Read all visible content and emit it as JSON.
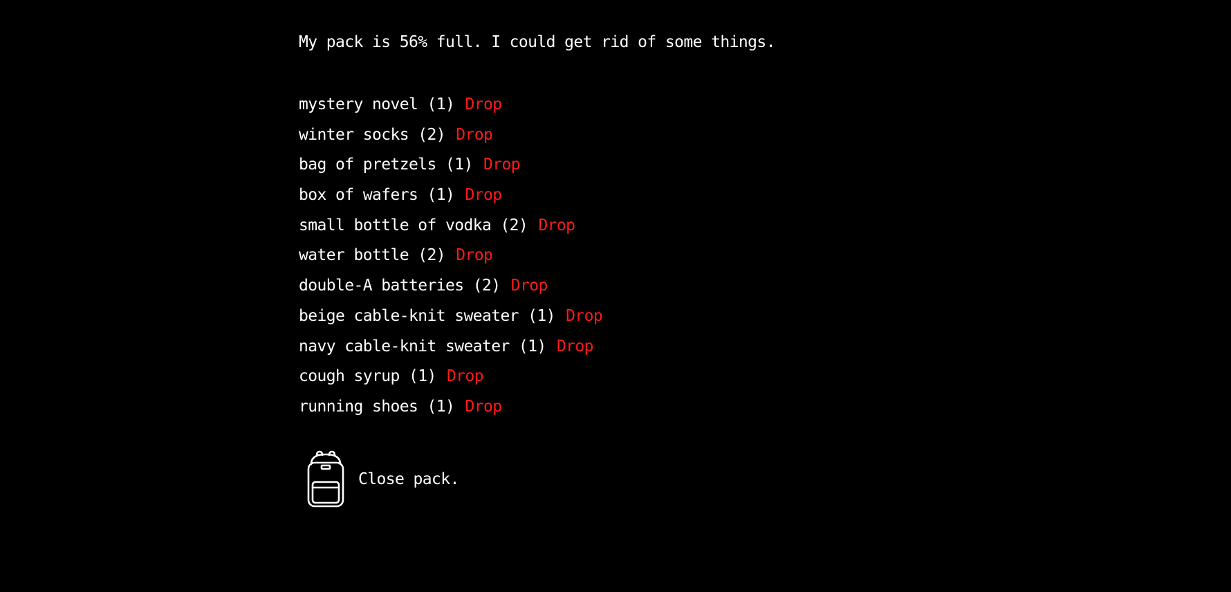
{
  "pack": {
    "status_text": "My pack is 56% full. I could get rid of some things.",
    "drop_label": "Drop",
    "items": [
      {
        "label": "mystery novel (1)"
      },
      {
        "label": "winter socks (2)"
      },
      {
        "label": "bag of pretzels (1)"
      },
      {
        "label": "box of wafers (1)"
      },
      {
        "label": "small bottle of vodka (2)"
      },
      {
        "label": "water bottle (2)"
      },
      {
        "label": "double-A batteries (2)"
      },
      {
        "label": "beige cable-knit sweater (1)"
      },
      {
        "label": "navy cable-knit sweater (1)"
      },
      {
        "label": "cough syrup (1)"
      },
      {
        "label": "running shoes (1)"
      }
    ],
    "close_label": "Close pack.",
    "close_icon": "backpack-icon"
  },
  "colors": {
    "background": "#000000",
    "text": "#ffffff",
    "drop": "#ff1a1a"
  }
}
